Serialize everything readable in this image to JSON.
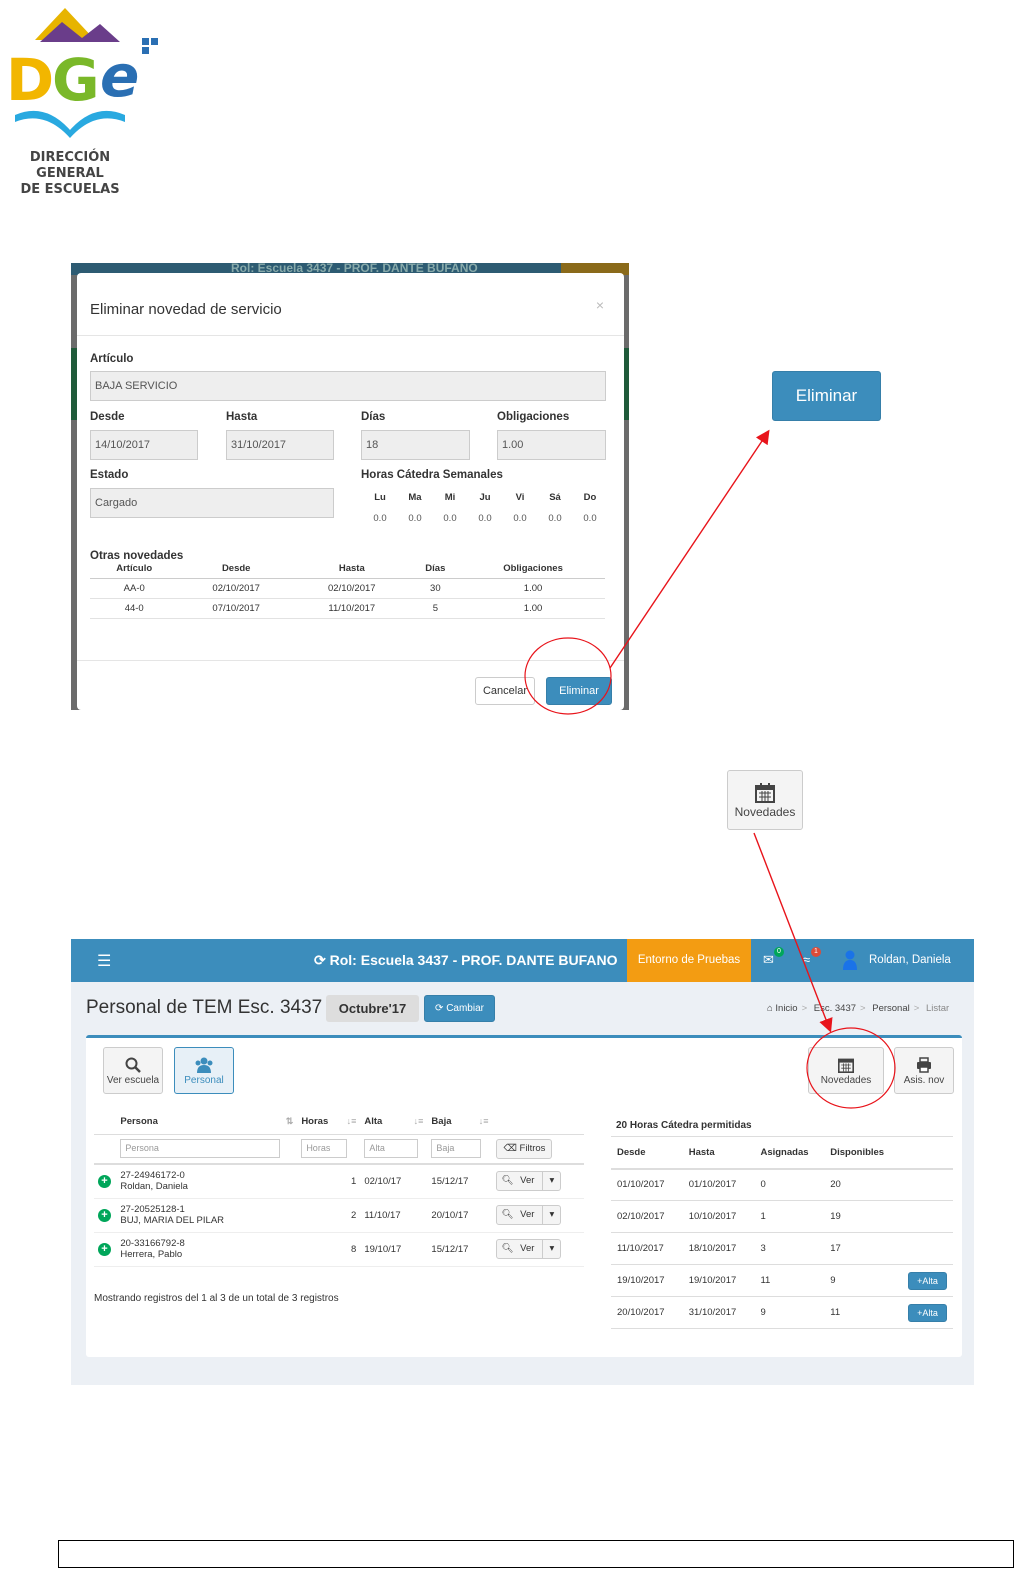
{
  "logo": {
    "brand": "DGe",
    "line1": "DIRECCIÓN GENERAL",
    "line2": "DE ESCUELAS"
  },
  "modal_screenshot": {
    "background_title": "Rol: Escuela 3437 - PROF. DANTE BUFANO",
    "background_entorno": "Entorno d",
    "title": "Eliminar novedad de servicio",
    "close": "×",
    "articulo_label": "Artículo",
    "articulo_value": "BAJA SERVICIO",
    "desde_label": "Desde",
    "desde_value": "14/10/2017",
    "hasta_label": "Hasta",
    "hasta_value": "31/10/2017",
    "dias_label": "Días",
    "dias_value": "18",
    "obligaciones_label": "Obligaciones",
    "obligaciones_value": "1.00",
    "estado_label": "Estado",
    "estado_value": "Cargado",
    "horas_label": "Horas Cátedra Semanales",
    "horas_days": [
      "Lu",
      "Ma",
      "Mi",
      "Ju",
      "Vi",
      "Sá",
      "Do"
    ],
    "horas_values": [
      "0.0",
      "0.0",
      "0.0",
      "0.0",
      "0.0",
      "0.0",
      "0.0"
    ],
    "otras_label": "Otras novedades",
    "otras_headers": [
      "Artículo",
      "Desde",
      "Hasta",
      "Días",
      "Obligaciones"
    ],
    "otras_rows": [
      [
        "AA-0",
        "02/10/2017",
        "02/10/2017",
        "30",
        "1.00"
      ],
      [
        "44-0",
        "07/10/2017",
        "11/10/2017",
        "5",
        "1.00"
      ]
    ],
    "cancelar": "Cancelar",
    "eliminar": "Eliminar"
  },
  "callouts": {
    "eliminar": "Eliminar",
    "novedades": "Novedades"
  },
  "app_screenshot": {
    "rol_title": "Rol: Escuela 3437 - PROF. DANTE BUFANO",
    "entorno": "Entorno de Pruebas",
    "mail_badge": "0",
    "alert_badge": "1",
    "user": "Roldan, Daniela",
    "page_title": "Personal de TEM Esc. 3437 -",
    "mes": "Octubre'17",
    "cambiar": "Cambiar",
    "breadcrumb": [
      "Inicio",
      "Esc. 3437",
      "Personal",
      "Listar"
    ],
    "ver_escuela": "Ver escuela",
    "personal": "Personal",
    "novedades": "Novedades",
    "asis_nov": "Asis. nov",
    "table_headers": [
      "Persona",
      "Horas",
      "Alta",
      "Baja"
    ],
    "filter_placeholders": [
      "Persona",
      "Horas",
      "Alta",
      "Baja"
    ],
    "filtros": "Filtros",
    "ver": "Ver",
    "rows": [
      {
        "cuil": "27-24946172-0",
        "name": "Roldan, Daniela",
        "horas": "1",
        "alta": "02/10/17",
        "baja": "15/12/17"
      },
      {
        "cuil": "27-20525128-1",
        "name": "BUJ, MARIA DEL PILAR",
        "horas": "2",
        "alta": "11/10/17",
        "baja": "20/10/17"
      },
      {
        "cuil": "20-33166792-8",
        "name": "Herrera, Pablo",
        "horas": "8",
        "alta": "19/10/17",
        "baja": "15/12/17"
      }
    ],
    "mostrando": "Mostrando registros del 1 al 3 de un total de 3 registros",
    "hc_title": "20 Horas Cátedra permitidas",
    "hc_headers": [
      "Desde",
      "Hasta",
      "Asignadas",
      "Disponibles"
    ],
    "hc_rows": [
      {
        "desde": "01/10/2017",
        "hasta": "01/10/2017",
        "asignadas": "0",
        "disponibles": "20",
        "alta": false
      },
      {
        "desde": "02/10/2017",
        "hasta": "10/10/2017",
        "asignadas": "1",
        "disponibles": "19",
        "alta": false
      },
      {
        "desde": "11/10/2017",
        "hasta": "18/10/2017",
        "asignadas": "3",
        "disponibles": "17",
        "alta": false
      },
      {
        "desde": "19/10/2017",
        "hasta": "19/10/2017",
        "asignadas": "11",
        "disponibles": "9",
        "alta": true
      },
      {
        "desde": "20/10/2017",
        "hasta": "31/10/2017",
        "asignadas": "9",
        "disponibles": "11",
        "alta": true
      }
    ],
    "alta": "Alta"
  },
  "colors": {
    "primary": "#3c8dbc",
    "orange": "#f39c12",
    "annotation": "#e8141b",
    "success": "#00a65a"
  }
}
